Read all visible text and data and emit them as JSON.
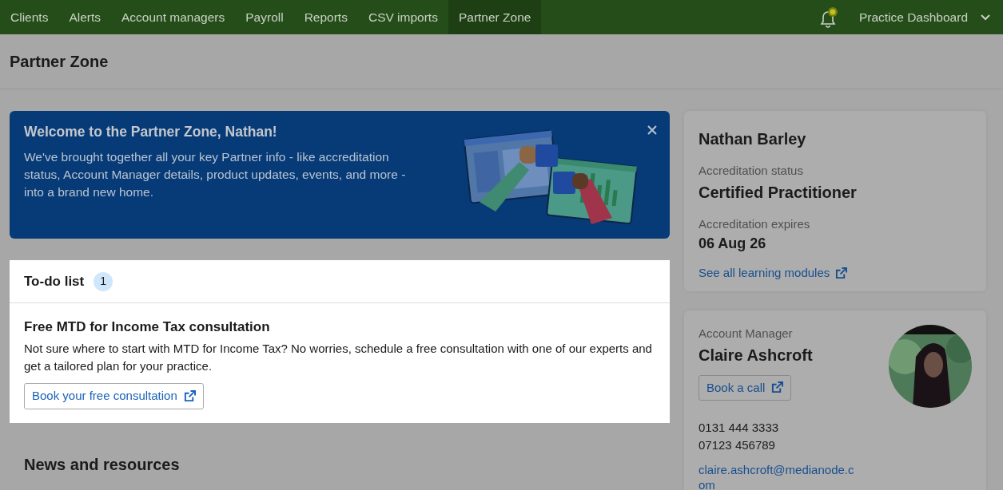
{
  "nav": {
    "items": [
      {
        "label": "Clients",
        "selected": false
      },
      {
        "label": "Alerts",
        "selected": false
      },
      {
        "label": "Account managers",
        "selected": false
      },
      {
        "label": "Payroll",
        "selected": false
      },
      {
        "label": "Reports",
        "selected": false
      },
      {
        "label": "CSV imports",
        "selected": false
      },
      {
        "label": "Partner Zone",
        "selected": true
      }
    ],
    "notification_unread": true,
    "account_menu": "Practice Dashboard"
  },
  "page_title": "Partner Zone",
  "banner": {
    "title": "Welcome to the Partner Zone, Nathan!",
    "text": "We've brought together all your key Partner info - like accreditation status, Account Manager details, product updates, events, and more - into a brand new home."
  },
  "todo": {
    "title": "To-do list",
    "count": "1",
    "items": [
      {
        "title": "Free MTD for Income Tax consultation",
        "text": "Not sure where to start with MTD for Income Tax? No worries, schedule a free consultation with one of our experts and get a tailored plan for your practice.",
        "button": "Book your free consultation"
      }
    ]
  },
  "news": {
    "title": "News and resources"
  },
  "profile": {
    "name": "Nathan Barley",
    "status_label": "Accreditation status",
    "status": "Certified Practitioner",
    "expires_label": "Accreditation expires",
    "expires": "06 Aug 26",
    "link": "See all learning modules"
  },
  "manager": {
    "label": "Account Manager",
    "name": "Claire Ashcroft",
    "button": "Book a call",
    "phones": [
      "0131 444 3333",
      "07123 456789"
    ],
    "email": "claire.ashcroft@medianode.com"
  }
}
